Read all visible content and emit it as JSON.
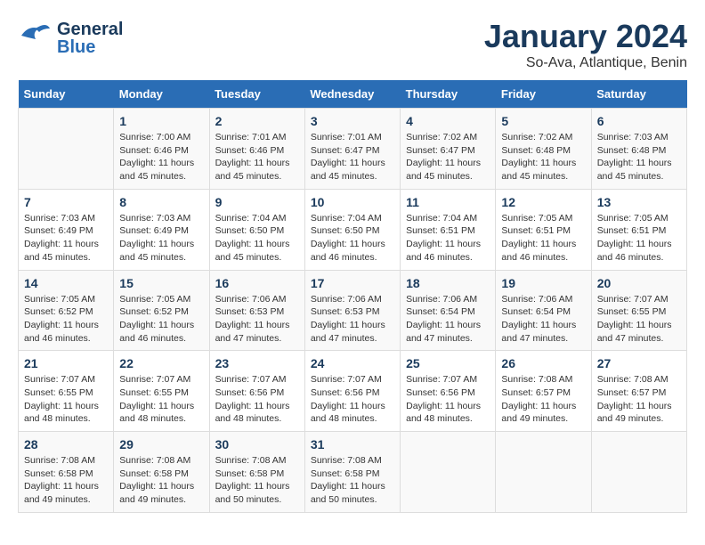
{
  "header": {
    "logo_general": "General",
    "logo_blue": "Blue",
    "month": "January 2024",
    "location": "So-Ava, Atlantique, Benin"
  },
  "columns": [
    "Sunday",
    "Monday",
    "Tuesday",
    "Wednesday",
    "Thursday",
    "Friday",
    "Saturday"
  ],
  "weeks": [
    [
      {
        "day": "",
        "info": ""
      },
      {
        "day": "1",
        "info": "Sunrise: 7:00 AM\nSunset: 6:46 PM\nDaylight: 11 hours\nand 45 minutes."
      },
      {
        "day": "2",
        "info": "Sunrise: 7:01 AM\nSunset: 6:46 PM\nDaylight: 11 hours\nand 45 minutes."
      },
      {
        "day": "3",
        "info": "Sunrise: 7:01 AM\nSunset: 6:47 PM\nDaylight: 11 hours\nand 45 minutes."
      },
      {
        "day": "4",
        "info": "Sunrise: 7:02 AM\nSunset: 6:47 PM\nDaylight: 11 hours\nand 45 minutes."
      },
      {
        "day": "5",
        "info": "Sunrise: 7:02 AM\nSunset: 6:48 PM\nDaylight: 11 hours\nand 45 minutes."
      },
      {
        "day": "6",
        "info": "Sunrise: 7:03 AM\nSunset: 6:48 PM\nDaylight: 11 hours\nand 45 minutes."
      }
    ],
    [
      {
        "day": "7",
        "info": "Sunrise: 7:03 AM\nSunset: 6:49 PM\nDaylight: 11 hours\nand 45 minutes."
      },
      {
        "day": "8",
        "info": "Sunrise: 7:03 AM\nSunset: 6:49 PM\nDaylight: 11 hours\nand 45 minutes."
      },
      {
        "day": "9",
        "info": "Sunrise: 7:04 AM\nSunset: 6:50 PM\nDaylight: 11 hours\nand 45 minutes."
      },
      {
        "day": "10",
        "info": "Sunrise: 7:04 AM\nSunset: 6:50 PM\nDaylight: 11 hours\nand 46 minutes."
      },
      {
        "day": "11",
        "info": "Sunrise: 7:04 AM\nSunset: 6:51 PM\nDaylight: 11 hours\nand 46 minutes."
      },
      {
        "day": "12",
        "info": "Sunrise: 7:05 AM\nSunset: 6:51 PM\nDaylight: 11 hours\nand 46 minutes."
      },
      {
        "day": "13",
        "info": "Sunrise: 7:05 AM\nSunset: 6:51 PM\nDaylight: 11 hours\nand 46 minutes."
      }
    ],
    [
      {
        "day": "14",
        "info": "Sunrise: 7:05 AM\nSunset: 6:52 PM\nDaylight: 11 hours\nand 46 minutes."
      },
      {
        "day": "15",
        "info": "Sunrise: 7:05 AM\nSunset: 6:52 PM\nDaylight: 11 hours\nand 46 minutes."
      },
      {
        "day": "16",
        "info": "Sunrise: 7:06 AM\nSunset: 6:53 PM\nDaylight: 11 hours\nand 47 minutes."
      },
      {
        "day": "17",
        "info": "Sunrise: 7:06 AM\nSunset: 6:53 PM\nDaylight: 11 hours\nand 47 minutes."
      },
      {
        "day": "18",
        "info": "Sunrise: 7:06 AM\nSunset: 6:54 PM\nDaylight: 11 hours\nand 47 minutes."
      },
      {
        "day": "19",
        "info": "Sunrise: 7:06 AM\nSunset: 6:54 PM\nDaylight: 11 hours\nand 47 minutes."
      },
      {
        "day": "20",
        "info": "Sunrise: 7:07 AM\nSunset: 6:55 PM\nDaylight: 11 hours\nand 47 minutes."
      }
    ],
    [
      {
        "day": "21",
        "info": "Sunrise: 7:07 AM\nSunset: 6:55 PM\nDaylight: 11 hours\nand 48 minutes."
      },
      {
        "day": "22",
        "info": "Sunrise: 7:07 AM\nSunset: 6:55 PM\nDaylight: 11 hours\nand 48 minutes."
      },
      {
        "day": "23",
        "info": "Sunrise: 7:07 AM\nSunset: 6:56 PM\nDaylight: 11 hours\nand 48 minutes."
      },
      {
        "day": "24",
        "info": "Sunrise: 7:07 AM\nSunset: 6:56 PM\nDaylight: 11 hours\nand 48 minutes."
      },
      {
        "day": "25",
        "info": "Sunrise: 7:07 AM\nSunset: 6:56 PM\nDaylight: 11 hours\nand 48 minutes."
      },
      {
        "day": "26",
        "info": "Sunrise: 7:08 AM\nSunset: 6:57 PM\nDaylight: 11 hours\nand 49 minutes."
      },
      {
        "day": "27",
        "info": "Sunrise: 7:08 AM\nSunset: 6:57 PM\nDaylight: 11 hours\nand 49 minutes."
      }
    ],
    [
      {
        "day": "28",
        "info": "Sunrise: 7:08 AM\nSunset: 6:58 PM\nDaylight: 11 hours\nand 49 minutes."
      },
      {
        "day": "29",
        "info": "Sunrise: 7:08 AM\nSunset: 6:58 PM\nDaylight: 11 hours\nand 49 minutes."
      },
      {
        "day": "30",
        "info": "Sunrise: 7:08 AM\nSunset: 6:58 PM\nDaylight: 11 hours\nand 50 minutes."
      },
      {
        "day": "31",
        "info": "Sunrise: 7:08 AM\nSunset: 6:58 PM\nDaylight: 11 hours\nand 50 minutes."
      },
      {
        "day": "",
        "info": ""
      },
      {
        "day": "",
        "info": ""
      },
      {
        "day": "",
        "info": ""
      }
    ]
  ]
}
